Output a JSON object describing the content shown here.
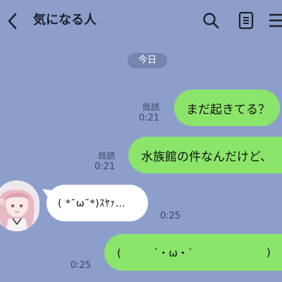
{
  "header": {
    "title": "気になる人"
  },
  "date_separator": "今日",
  "messages": [
    {
      "id": "msg1",
      "side": "sent",
      "text": "まだ起きてる？",
      "read_label": "既読",
      "time": "0:21"
    },
    {
      "id": "msg2",
      "side": "sent",
      "text": "水族館の件なんだけど、",
      "read_label": "既読",
      "time": "0:21"
    },
    {
      "id": "msg3",
      "side": "received",
      "text": "( *˘ω˘*)ｽﾔｧ…",
      "time": "0:25"
    },
    {
      "id": "msg4",
      "side": "sent",
      "text_left": "(　　　´・ω・`",
      "text_right": ")",
      "time": "0:25"
    }
  ],
  "colors": {
    "background": "#8C9FCA",
    "sent_bubble": "#8CE56B",
    "received_bubble": "#FFFFFF",
    "header_icons": "#1C1F2A"
  },
  "icons": {
    "back": "chevron-left-icon",
    "search": "search-icon",
    "notes": "notes-icon",
    "menu": "menu-icon"
  }
}
